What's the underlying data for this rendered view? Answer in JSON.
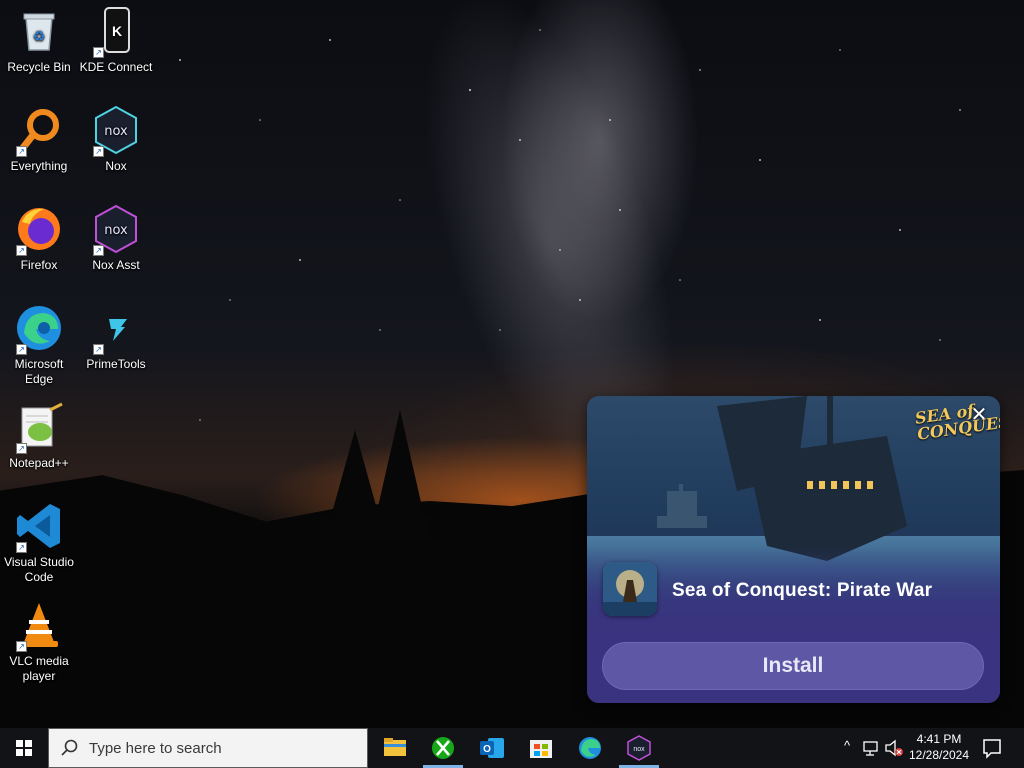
{
  "desktop": {
    "icons": [
      {
        "label": "Recycle Bin",
        "icon": "recycle-bin-icon"
      },
      {
        "label": "KDE Connect",
        "icon": "kde-connect-icon"
      },
      {
        "label": "Everything",
        "icon": "everything-search-icon"
      },
      {
        "label": "Nox",
        "icon": "nox-icon"
      },
      {
        "label": "Firefox",
        "icon": "firefox-icon"
      },
      {
        "label": "Nox Asst",
        "icon": "nox-assistant-icon"
      },
      {
        "label": "Microsoft Edge",
        "icon": "edge-icon"
      },
      {
        "label": "PrimeTools",
        "icon": "primetools-icon"
      },
      {
        "label": "Notepad++",
        "icon": "notepadpp-icon"
      },
      {
        "label": "Visual Studio Code",
        "icon": "vscode-icon"
      },
      {
        "label": "VLC media player",
        "icon": "vlc-icon"
      }
    ]
  },
  "popup": {
    "logo_text": "SEA of CONQUEST",
    "close_glyph": "✕",
    "app_title": "Sea of Conquest: Pirate War",
    "install_label": "Install",
    "colors": {
      "button": "#5d57a6",
      "panel": "#3a3480"
    }
  },
  "taskbar": {
    "search_placeholder": "Type here to search",
    "pinned": [
      "file-explorer-icon",
      "xbox-icon",
      "outlook-icon",
      "microsoft-store-icon",
      "edge-icon",
      "nox-icon"
    ],
    "tray_chevron": "^",
    "time": "4:41 PM",
    "date": "12/28/2024"
  }
}
